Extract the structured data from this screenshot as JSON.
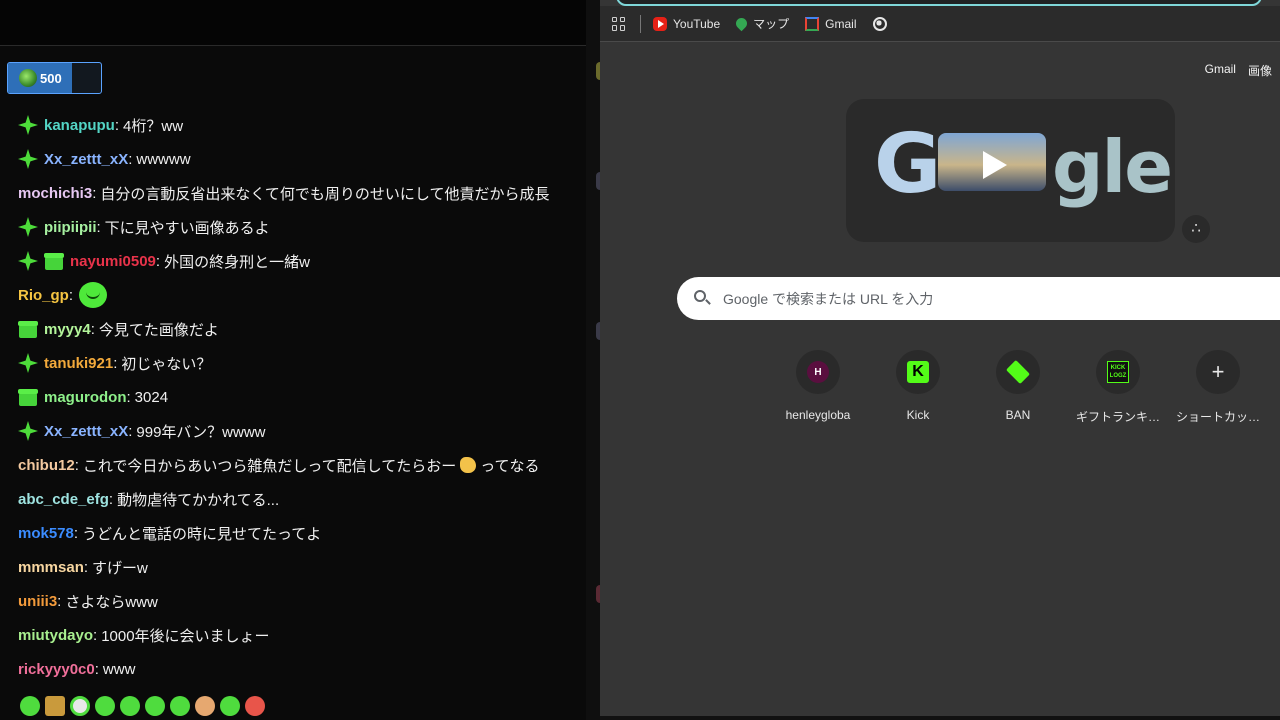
{
  "chat": {
    "pinned_count": "500",
    "messages": [
      {
        "badges": [
          "star"
        ],
        "user": "kanapupu",
        "color": "#53d5c5",
        "text": "4桁？ww"
      },
      {
        "badges": [
          "star"
        ],
        "user": "Xx_zettt_xX",
        "color": "#8ab4ff",
        "text": "wwwww"
      },
      {
        "badges": [],
        "user": "mochichi3",
        "color": "#e6c7f2",
        "text": "自分の言動反省出来なくて何でも周りのせいにして他責だから成長"
      },
      {
        "badges": [
          "star"
        ],
        "user": "piipiipii",
        "color": "#a6f0a0",
        "text": "下に見やすい画像あるよ"
      },
      {
        "badges": [
          "star",
          "gift"
        ],
        "user": "nayumi0509",
        "color": "#e8334a",
        "text": "外国の終身刑と一緒w"
      },
      {
        "badges": [],
        "user": "Rio_gp",
        "color": "#f5c542",
        "text": "",
        "emote": "smile-blob"
      },
      {
        "badges": [
          "gift"
        ],
        "user": "myyy4",
        "color": "#b3f59a",
        "text": "今見てた画像だよ"
      },
      {
        "badges": [
          "star"
        ],
        "user": "tanuki921",
        "color": "#f2a93b",
        "text": "初じゃない？"
      },
      {
        "badges": [
          "gift"
        ],
        "user": "magurodon",
        "color": "#8ef08a",
        "text": "3024"
      },
      {
        "badges": [
          "star"
        ],
        "user": "Xx_zettt_xX",
        "color": "#8ab4ff",
        "text": "999年バン？wwww"
      },
      {
        "badges": [],
        "user": "chibu12",
        "color": "#f3c9a0",
        "text": "これで今日からあいつら雑魚だしって配信してたらおー",
        "text2": "ってなる"
      },
      {
        "badges": [],
        "user": "abc_cde_efg",
        "color": "#9ee3e0",
        "text": "動物虐待てかかれてる..."
      },
      {
        "badges": [],
        "user": "mok578",
        "color": "#3b8cff",
        "text": "うどんと電話の時に見せてたってよ"
      },
      {
        "badges": [],
        "user": "mmmsan",
        "color": "#f7d6a0",
        "text": "すげーw"
      },
      {
        "badges": [],
        "user": "uniii3",
        "color": "#f29a3b",
        "text": "さよならwww"
      },
      {
        "badges": [],
        "user": "miutydayo",
        "color": "#a8ef8f",
        "text": "1000年後に会いましょー"
      },
      {
        "badges": [],
        "user": "rickyyy0c0",
        "color": "#f06f9a",
        "text": "www"
      }
    ]
  },
  "bookmarks": [
    {
      "label": "YouTube",
      "icon": "youtube-icon"
    },
    {
      "label": "マップ",
      "icon": "maps-icon"
    },
    {
      "label": "Gmail",
      "icon": "gmail-icon"
    }
  ],
  "top_links": {
    "gmail": "Gmail",
    "images": "画像"
  },
  "search": {
    "placeholder": "Google で検索または URL を入力"
  },
  "shortcuts": [
    {
      "label": "henleygloba",
      "icon": "henley-favicon"
    },
    {
      "label": "Kick",
      "icon": "kick-favicon"
    },
    {
      "label": "BAN",
      "icon": "ban-hammer-favicon"
    },
    {
      "label": "ギフトランキ…",
      "icon": "kick-logoz-favicon"
    },
    {
      "label": "ショートカッ…",
      "icon": "plus-icon"
    }
  ],
  "colors": {
    "accent_green": "#53fc18",
    "pin_blue": "#2e6fb8",
    "browser_bg": "#353535"
  }
}
